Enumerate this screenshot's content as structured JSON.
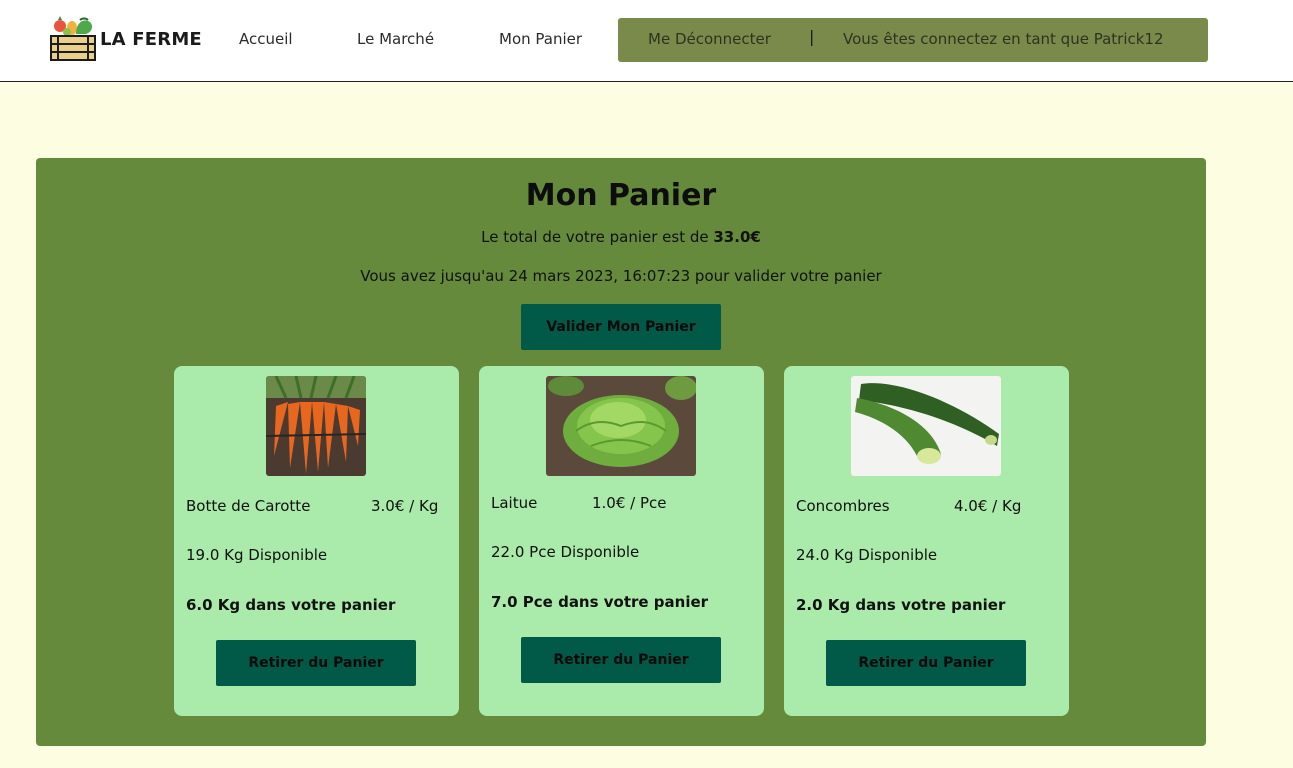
{
  "brand": {
    "name": "LA FERME",
    "logo_icon": "vegetable-crate-icon"
  },
  "nav": {
    "accueil": "Accueil",
    "marche": "Le Marché",
    "panier": "Mon Panier"
  },
  "user_bar": {
    "logout_label": "Me Déconnecter",
    "separator": "|",
    "status": "Vous êtes connectez en tant que Patrick12"
  },
  "cart": {
    "title": "Mon Panier",
    "total_prefix": "Le total de votre panier est de ",
    "total_value": "33.0€",
    "deadline": "Vous avez jusqu'au 24 mars 2023, 16:07:23 pour valider votre panier",
    "validate_label": "Valider Mon Panier"
  },
  "products": [
    {
      "name": "Botte de Carotte",
      "price": "3.0€ / Kg",
      "stock": "19.0 Kg Disponible",
      "in_cart": "6.0 Kg dans votre panier",
      "remove_label": "Retirer du Panier",
      "image_icon": "carrots-photo"
    },
    {
      "name": "Laitue",
      "price": "1.0€ / Pce",
      "stock": "22.0 Pce Disponible",
      "in_cart": "7.0 Pce dans votre panier",
      "remove_label": "Retirer du Panier",
      "image_icon": "lettuce-photo"
    },
    {
      "name": "Concombres",
      "price": "4.0€ / Kg",
      "stock": "24.0 Kg Disponible",
      "in_cart": "2.0 Kg dans votre panier",
      "remove_label": "Retirer du Panier",
      "image_icon": "cucumber-photo"
    }
  ],
  "colors": {
    "page_bg": "#fdfde2",
    "user_bar_bg": "#7a8a4a",
    "panel_bg": "#668a3b",
    "card_bg": "#aaeaaa",
    "button_bg": "#005a47"
  }
}
